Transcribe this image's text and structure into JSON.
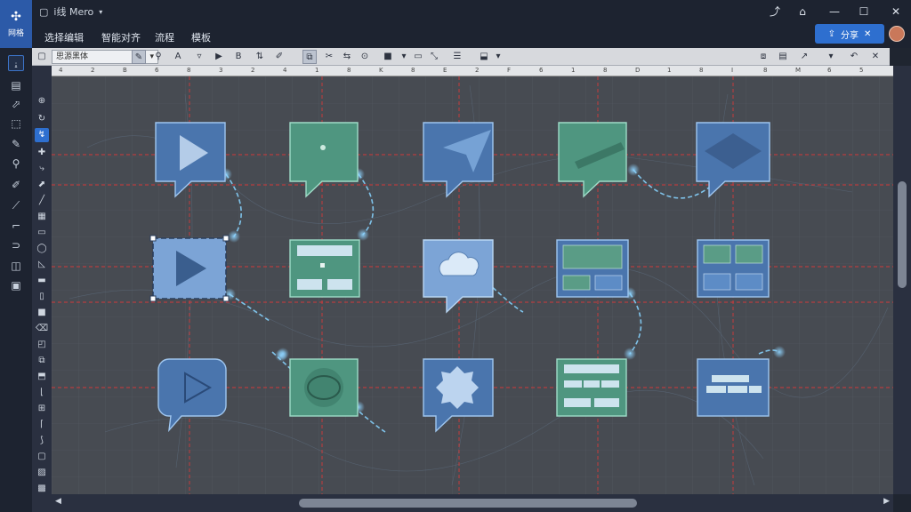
{
  "app": {
    "logo_label": "网格",
    "document_title": "i线 Mero",
    "title_caret": "▾"
  },
  "menu": {
    "items": [
      {
        "label": "选择编辑"
      },
      {
        "label": "智能对齐"
      },
      {
        "label": "流程"
      },
      {
        "label": "模板"
      }
    ],
    "share_label": "分享"
  },
  "format_bar": {
    "font_value": "思源黑体",
    "font_caret": "▾"
  },
  "ruler": {
    "labels": [
      "4",
      "2",
      "B",
      "6",
      "8",
      "3",
      "2",
      "4",
      "1",
      "8",
      "K",
      "8",
      "E",
      "2",
      "F",
      "6",
      "1",
      "8",
      "D",
      "1",
      "8",
      "I",
      "8",
      "M",
      "6",
      "5"
    ]
  },
  "canvas": {
    "shapes": [
      {
        "type": "callout",
        "icon": "play-icon",
        "color": "blue"
      },
      {
        "type": "callout",
        "icon": "dot-icon",
        "color": "green"
      },
      {
        "type": "callout",
        "icon": "send-icon",
        "color": "blue"
      },
      {
        "type": "callout",
        "icon": "pen-icon",
        "color": "green"
      },
      {
        "type": "callout",
        "icon": "diamond-icon",
        "color": "blue"
      },
      {
        "type": "card",
        "icon": "play-icon",
        "color": "light-blue",
        "selected": true
      },
      {
        "type": "card",
        "icon": "panel-icon",
        "color": "green"
      },
      {
        "type": "callout",
        "icon": "cloud-icon",
        "color": "light-blue"
      },
      {
        "type": "card",
        "icon": "panel-icon",
        "color": "blue"
      },
      {
        "type": "card",
        "icon": "grid-icon",
        "color": "blue"
      },
      {
        "type": "speech",
        "icon": "play-icon",
        "color": "blue"
      },
      {
        "type": "card",
        "icon": "ring-icon",
        "color": "green"
      },
      {
        "type": "callout",
        "icon": "badge-icon",
        "color": "blue"
      },
      {
        "type": "card",
        "icon": "list-icon",
        "color": "green"
      },
      {
        "type": "card",
        "icon": "bars-icon",
        "color": "blue"
      }
    ]
  },
  "colors": {
    "accent": "#2e6fcf",
    "blue_fill": "#4a75ad",
    "green_fill": "#4f9680",
    "light_blue_fill": "#7ca4d6",
    "guide_red": "#d23a3a",
    "connector": "#7fc3ea"
  }
}
